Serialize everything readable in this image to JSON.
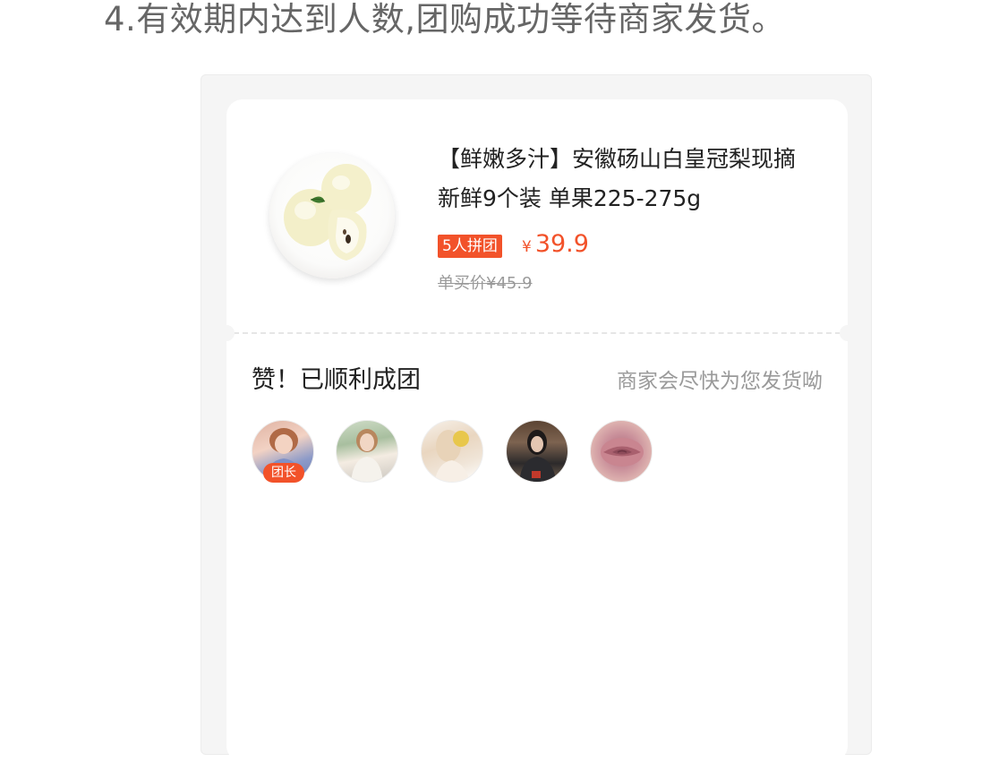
{
  "heading": "4.有效期内达到人数,团购成功等待商家发货。",
  "product": {
    "title": "【鲜嫩多汁】安徽砀山白皇冠梨现摘 新鲜9个装 单果225-275g",
    "group_badge": "5人拼团",
    "currency": "¥",
    "price": "39.9",
    "original_price": "单买价¥45.9"
  },
  "group": {
    "success_title": "赞！已顺利成团",
    "success_subtitle": "商家会尽快为您发货呦",
    "leader_label": "团长",
    "members": [
      "leader-avatar",
      "member-avatar",
      "member-avatar",
      "member-avatar",
      "member-avatar"
    ]
  },
  "colors": {
    "accent": "#f2522a",
    "muted_text": "#9a9a9a",
    "background": "#f5f5f5"
  }
}
